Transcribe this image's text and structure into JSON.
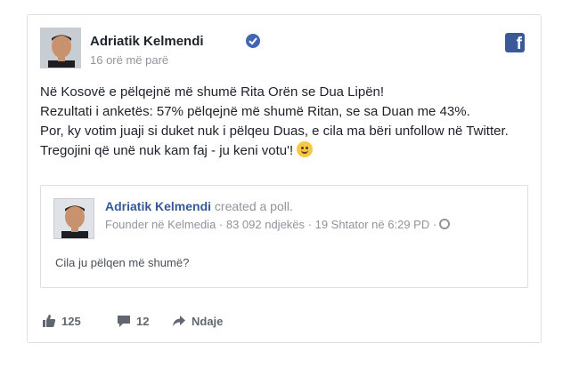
{
  "post": {
    "author": "Adriatik Kelmendi",
    "timestamp": "16 orë më parë",
    "lines": [
      "Në Kosovë e pëlqejnë më shumë Rita Orën se Dua Lipën!",
      "Rezultati i anketës: 57% pëlqejnë më shumë Ritan, se sa Duan me 43%.",
      "Por, ky votim juaji si duket nuk i pëlqeu Duas, e cila ma bëri unfollow në Twitter.",
      "Tregojini që unë nuk kam faj - ju keni votu'!"
    ]
  },
  "shared": {
    "author": "Adriatik Kelmendi",
    "action": "created a poll.",
    "meta": "Founder në Kelmedia · 83 092 ndjekës · 19 Shtator në 6:29 PD ·",
    "question": "Cila ju pëlqen më shumë?"
  },
  "actions": {
    "likes": "125",
    "comments": "12",
    "share": "Ndaje"
  },
  "colors": {
    "facebook_blue": "#3b5998",
    "link_blue": "#365899",
    "meta_gray": "#90949c"
  },
  "icons": {
    "brand": "facebook-logo-icon",
    "verified": "verified-badge-icon",
    "privacy": "globe-icon",
    "like": "thumbs-up-icon",
    "comment": "comment-bubble-icon",
    "share": "share-arrow-icon"
  }
}
